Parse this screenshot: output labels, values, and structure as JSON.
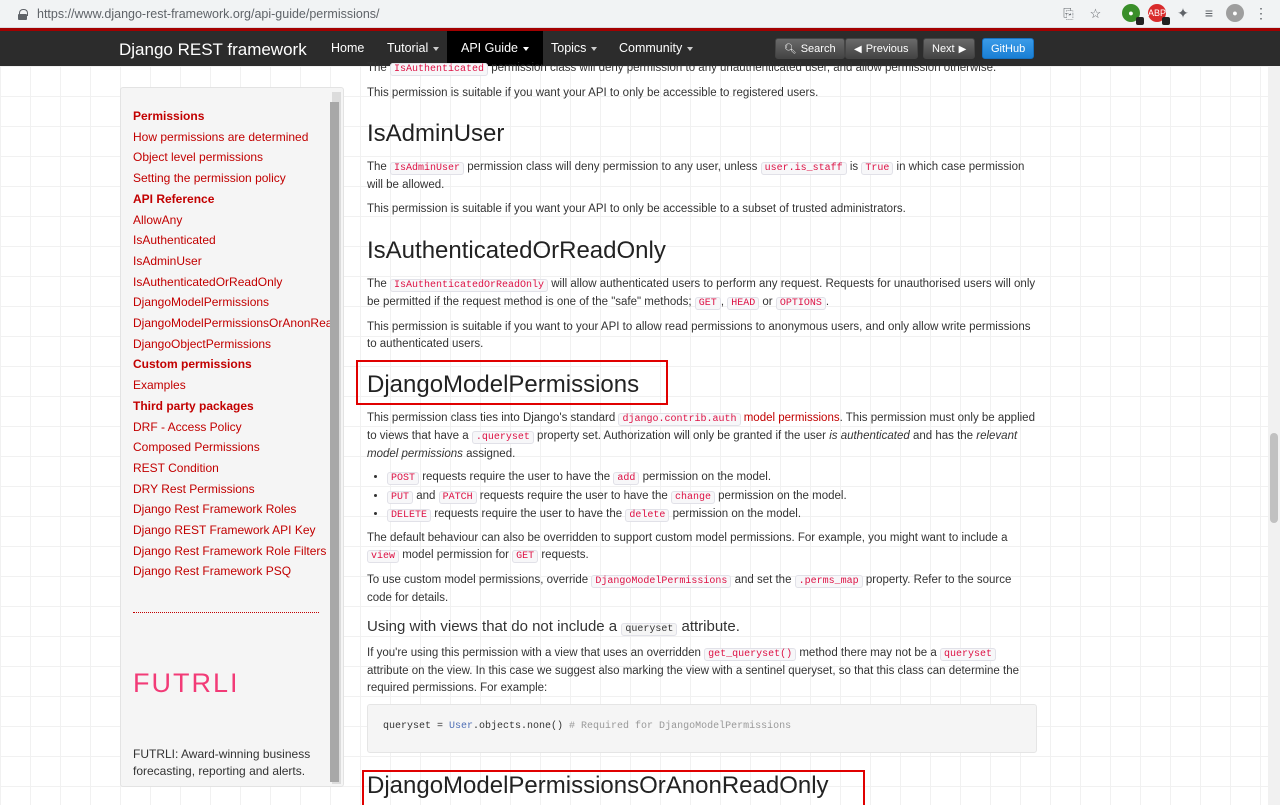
{
  "browser": {
    "url_host": "https://www.django-rest-framework.org",
    "url_path": "/api-guide/permissions/"
  },
  "navbar": {
    "brand": "Django REST framework",
    "items": [
      "Home",
      "Tutorial",
      "API Guide",
      "Topics",
      "Community"
    ],
    "buttons": {
      "search": "Search",
      "previous": "Previous",
      "next": "Next",
      "github": "GitHub"
    }
  },
  "sidebar": {
    "items": [
      {
        "label": "Permissions",
        "head": true
      },
      {
        "label": "How permissions are determined"
      },
      {
        "label": "Object level permissions"
      },
      {
        "label": "Setting the permission policy"
      },
      {
        "label": "API Reference",
        "head": true
      },
      {
        "label": "AllowAny"
      },
      {
        "label": "IsAuthenticated"
      },
      {
        "label": "IsAdminUser"
      },
      {
        "label": "IsAuthenticatedOrReadOnly"
      },
      {
        "label": "DjangoModelPermissions"
      },
      {
        "label": "DjangoModelPermissionsOrAnonReadOnly"
      },
      {
        "label": "DjangoObjectPermissions"
      },
      {
        "label": "Custom permissions",
        "head": true
      },
      {
        "label": "Examples"
      },
      {
        "label": "Third party packages",
        "head": true
      },
      {
        "label": "DRF - Access Policy"
      },
      {
        "label": "Composed Permissions"
      },
      {
        "label": "REST Condition"
      },
      {
        "label": "DRY Rest Permissions"
      },
      {
        "label": "Django Rest Framework Roles"
      },
      {
        "label": "Django REST Framework API Key"
      },
      {
        "label": "Django Rest Framework Role Filters",
        "wrap": true
      },
      {
        "label": "Django Rest Framework PSQ"
      }
    ],
    "sponsor_logo": "FUTRLI",
    "sponsor_text": "FUTRLI: Award-winning business forecasting, reporting and alerts."
  },
  "content": {
    "top_cut": [
      "The ",
      "IsAuthenticated",
      " permission class will deny permission to any unauthenticated user, and allow permission otherwise."
    ],
    "isauth_suitable": "This permission is suitable if you want your API to only be accessible to registered users.",
    "isadmin_title": "IsAdminUser",
    "isadmin_p1": [
      "The ",
      "IsAdminUser",
      " permission class will deny permission to any user, unless ",
      "user.is_staff",
      " is ",
      "True",
      " in which case permission will be allowed."
    ],
    "isadmin_p2": "This permission is suitable if you want your API to only be accessible to a subset of trusted administrators.",
    "isauthro_title": "IsAuthenticatedOrReadOnly",
    "isauthro_p1": [
      "The ",
      "IsAuthenticatedOrReadOnly",
      " will allow authenticated users to perform any request. Requests for unauthorised users will only be permitted if the request method is one of the \"safe\" methods; ",
      "GET",
      ", ",
      "HEAD",
      " or ",
      "OPTIONS",
      "."
    ],
    "isauthro_p2": "This permission is suitable if you want to your API to allow read permissions to anonymous users, and only allow write permissions to authenticated users.",
    "dmp_title": "DjangoModelPermissions",
    "dmp_p1": [
      "This permission class ties into Django's standard ",
      "django.contrib.auth",
      " ",
      "model permissions",
      ". This permission must only be applied to views that have a ",
      ".queryset",
      " property set. Authorization will only be granted if the user ",
      "is authenticated",
      " and has the ",
      "relevant model permissions",
      " assigned."
    ],
    "dmp_bullets": [
      [
        "",
        "POST",
        " requests require the user to have the ",
        "add",
        " permission on the model."
      ],
      [
        "",
        "PUT",
        " and ",
        "PATCH",
        " requests require the user to have the ",
        "change",
        " permission on the model."
      ],
      [
        "",
        "DELETE",
        " requests require the user to have the ",
        "delete",
        " permission on the model."
      ]
    ],
    "dmp_p2": [
      "The default behaviour can also be overridden to support custom model permissions. For example, you might want to include a ",
      "view",
      " model permission for ",
      "GET",
      " requests."
    ],
    "dmp_p3": [
      "To use custom model permissions, override ",
      "DjangoModelPermissions",
      " and set the ",
      ".perms_map",
      " property. Refer to the source code for details."
    ],
    "views_h3": [
      "Using with views that do not include a ",
      "queryset",
      " attribute."
    ],
    "views_p": [
      "If you're using this permission with a view that uses an overridden ",
      "get_queryset()",
      " method there may not be a ",
      "queryset",
      " attribute on the view. In this case we suggest also marking the view with a sentinel queryset, so that this class can determine the required permissions. For example:"
    ],
    "code": {
      "var": "queryset = ",
      "cls": "User",
      "rest": ".objects.none()  ",
      "comment": "# Required for DjangoModelPermissions"
    },
    "dmpoaro_title": "DjangoModelPermissionsOrAnonReadOnly"
  },
  "colors": {
    "accent": "#c20000",
    "navbar": "#2c2c2c",
    "highlight_box": "#e00000",
    "github_button": "#1a7fd4"
  }
}
